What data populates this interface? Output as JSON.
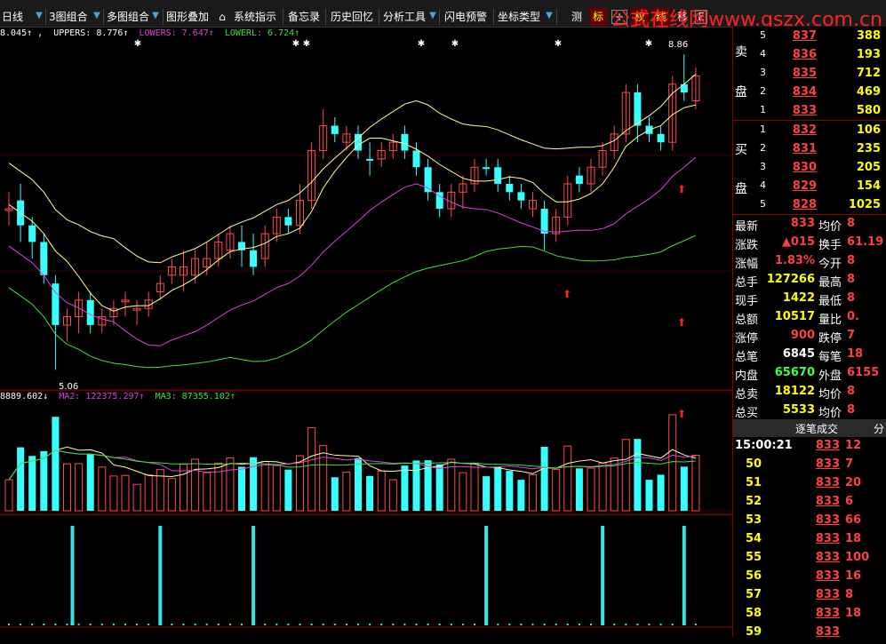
{
  "toolbar": {
    "period": "日线",
    "multi3": "3图组合",
    "multi": "多图组合",
    "overlay": "图形叠加",
    "indicators": "系统指示",
    "memo": "备忘录",
    "history": "历史回忆",
    "analysis": "分析工具",
    "alert": "闪电预警",
    "coord": "坐标类型",
    "measure": "测",
    "mark": "标",
    "quan": "权",
    "line": "线",
    "move": "移",
    "last": "E"
  },
  "watermark": "公式在线网www.gszx.com.cn",
  "legend_top": {
    "mid": "8.045↑",
    "upper": "UPPERS: 8.776↑",
    "lower": "LOWERS: 7.647↑",
    "lowerl": "LOWERL: 6.724↑"
  },
  "legend_vol": {
    "ma1": "8889.602↓",
    "ma2": "MA2: 122375.297↑",
    "ma3": "MA3: 87355.102↑"
  },
  "chart_labels": {
    "high": "8.86",
    "low": "5.06"
  },
  "chart_data": {
    "type": "candlestick",
    "colors": {
      "up": "#ff4b4b",
      "down": "#35ffff",
      "ma_white": "#ffffa0",
      "ma_magenta": "#e040e0",
      "ma_green": "#40e040"
    },
    "candles": [
      [
        7.0,
        7.2,
        6.8,
        7.0,
        "u"
      ],
      [
        7.1,
        7.3,
        6.6,
        6.8,
        "d"
      ],
      [
        6.8,
        6.9,
        6.4,
        6.6,
        "d"
      ],
      [
        6.6,
        6.7,
        6.1,
        6.2,
        "d"
      ],
      [
        6.1,
        6.2,
        5.06,
        5.6,
        "d"
      ],
      [
        5.6,
        5.8,
        5.4,
        5.7,
        "u"
      ],
      [
        5.7,
        6.0,
        5.5,
        5.9,
        "u"
      ],
      [
        5.9,
        6.0,
        5.5,
        5.6,
        "d"
      ],
      [
        5.6,
        5.8,
        5.5,
        5.7,
        "u"
      ],
      [
        5.7,
        5.9,
        5.6,
        5.8,
        "u"
      ],
      [
        5.9,
        6.0,
        5.7,
        5.9,
        "u"
      ],
      [
        5.8,
        5.9,
        5.6,
        5.8,
        "u"
      ],
      [
        5.8,
        6.0,
        5.7,
        5.9,
        "u"
      ],
      [
        6.0,
        6.2,
        5.9,
        6.1,
        "u"
      ],
      [
        6.2,
        6.4,
        6.1,
        6.3,
        "u"
      ],
      [
        6.3,
        6.5,
        6.0,
        6.2,
        "u"
      ],
      [
        6.2,
        6.5,
        6.1,
        6.4,
        "u"
      ],
      [
        6.3,
        6.6,
        6.2,
        6.4,
        "u"
      ],
      [
        6.4,
        6.7,
        6.3,
        6.6,
        "u"
      ],
      [
        6.5,
        6.8,
        6.4,
        6.7,
        "u"
      ],
      [
        6.6,
        6.8,
        6.3,
        6.5,
        "d"
      ],
      [
        6.5,
        6.7,
        6.2,
        6.3,
        "d"
      ],
      [
        6.4,
        6.8,
        6.3,
        6.7,
        "u"
      ],
      [
        6.7,
        7.0,
        6.6,
        6.9,
        "u"
      ],
      [
        6.9,
        7.0,
        6.7,
        6.8,
        "d"
      ],
      [
        6.8,
        7.3,
        6.7,
        7.1,
        "u"
      ],
      [
        7.1,
        7.8,
        7.0,
        7.7,
        "u"
      ],
      [
        7.7,
        8.2,
        7.6,
        8.0,
        "u"
      ],
      [
        8.0,
        8.1,
        7.8,
        7.9,
        "d"
      ],
      [
        7.8,
        8.0,
        7.7,
        7.9,
        "u"
      ],
      [
        7.9,
        8.0,
        7.6,
        7.7,
        "d"
      ],
      [
        7.6,
        7.8,
        7.4,
        7.6,
        "d"
      ],
      [
        7.6,
        7.8,
        7.5,
        7.7,
        "u"
      ],
      [
        7.7,
        7.9,
        7.6,
        7.8,
        "u"
      ],
      [
        7.9,
        8.0,
        7.6,
        7.7,
        "d"
      ],
      [
        7.7,
        7.8,
        7.4,
        7.5,
        "d"
      ],
      [
        7.5,
        7.6,
        7.1,
        7.2,
        "d"
      ],
      [
        7.2,
        7.3,
        6.9,
        7.0,
        "d"
      ],
      [
        7.0,
        7.3,
        6.9,
        7.2,
        "u"
      ],
      [
        7.2,
        7.4,
        7.0,
        7.3,
        "u"
      ],
      [
        7.3,
        7.6,
        7.2,
        7.5,
        "u"
      ],
      [
        7.5,
        7.6,
        7.4,
        7.5,
        "d"
      ],
      [
        7.5,
        7.6,
        7.2,
        7.3,
        "d"
      ],
      [
        7.3,
        7.4,
        7.1,
        7.2,
        "d"
      ],
      [
        7.2,
        7.3,
        7.0,
        7.1,
        "d"
      ],
      [
        7.1,
        7.2,
        6.9,
        7.0,
        "u"
      ],
      [
        7.0,
        7.1,
        6.5,
        6.7,
        "d"
      ],
      [
        6.7,
        7.0,
        6.6,
        6.9,
        "u"
      ],
      [
        6.9,
        7.4,
        6.8,
        7.3,
        "u"
      ],
      [
        7.3,
        7.5,
        7.2,
        7.4,
        "d"
      ],
      [
        7.3,
        7.6,
        7.2,
        7.5,
        "u"
      ],
      [
        7.5,
        7.8,
        7.4,
        7.7,
        "u"
      ],
      [
        7.7,
        8.0,
        7.6,
        7.9,
        "u"
      ],
      [
        7.9,
        8.5,
        7.8,
        8.4,
        "u"
      ],
      [
        8.4,
        8.5,
        7.8,
        8.0,
        "d"
      ],
      [
        8.0,
        8.1,
        7.8,
        7.9,
        "d"
      ],
      [
        7.9,
        8.0,
        7.7,
        7.8,
        "d"
      ],
      [
        7.8,
        8.6,
        7.7,
        8.5,
        "u"
      ],
      [
        8.5,
        8.86,
        8.3,
        8.4,
        "d"
      ],
      [
        8.3,
        8.7,
        8.2,
        8.6,
        "u"
      ]
    ],
    "volume_hint": "candle-colored bars",
    "signal_bars_index": [
      5,
      13,
      21,
      41,
      51,
      58
    ]
  },
  "orderbook": {
    "sell_label_1": "卖",
    "sell_label_2": "盘",
    "buy_label_1": "买",
    "buy_label_2": "盘",
    "sell": [
      {
        "n": "5",
        "p": "837",
        "v": "388"
      },
      {
        "n": "4",
        "p": "836",
        "v": "193"
      },
      {
        "n": "3",
        "p": "835",
        "v": "712"
      },
      {
        "n": "2",
        "p": "834",
        "v": "469"
      },
      {
        "n": "1",
        "p": "833",
        "v": "580"
      }
    ],
    "buy": [
      {
        "n": "1",
        "p": "832",
        "v": "106"
      },
      {
        "n": "2",
        "p": "831",
        "v": "235"
      },
      {
        "n": "3",
        "p": "830",
        "v": "205"
      },
      {
        "n": "4",
        "p": "829",
        "v": "154"
      },
      {
        "n": "5",
        "p": "828",
        "v": "1025"
      }
    ]
  },
  "quote": [
    {
      "l": "最新",
      "v": "833",
      "c": "#ff4040",
      "l2": "均价",
      "v2": "8"
    },
    {
      "l": "涨跌",
      "v": "▲015",
      "c": "#ff4040",
      "l2": "换手",
      "v2": "61.19"
    },
    {
      "l": "涨幅",
      "v": "1.83%",
      "c": "#ff4040",
      "l2": "今开",
      "v2": "8"
    },
    {
      "l": "总手",
      "v": "127266",
      "c": "#ffff00",
      "l2": "最高",
      "v2": "8"
    },
    {
      "l": "现手",
      "v": "1422",
      "c": "#ffff00",
      "l2": "最低",
      "v2": "8"
    },
    {
      "l": "总额",
      "v": "10517",
      "c": "#ffff00",
      "l2": "量比",
      "v2": "0."
    },
    {
      "l": "涨停",
      "v": "900",
      "c": "#ff4040",
      "l2": "跌停",
      "v2": "7"
    },
    {
      "l": "总笔",
      "v": "6845",
      "c": "#ffffff",
      "l2": "每笔",
      "v2": "18"
    },
    {
      "l": "内盘",
      "v": "65670",
      "c": "#40ff40",
      "l2": "外盘",
      "v2": "6155"
    },
    {
      "l": "总卖",
      "v": "18122",
      "c": "#ffff00",
      "l2": "均价",
      "v2": "8"
    },
    {
      "l": "总买",
      "v": "5533",
      "c": "#ffff00",
      "l2": "均价",
      "v2": "8"
    }
  ],
  "ticks_header": {
    "title": "逐笔成交",
    "extra": "分"
  },
  "ticks": [
    {
      "t": "15:00:21",
      "p": "833",
      "v": "12",
      "tc": "#ffffff"
    },
    {
      "t": "50",
      "p": "833",
      "v": "7",
      "tc": "#ffff00"
    },
    {
      "t": "51",
      "p": "833",
      "v": "20",
      "tc": "#ffff00"
    },
    {
      "t": "52",
      "p": "833",
      "v": "6",
      "tc": "#ffff00"
    },
    {
      "t": "53",
      "p": "833",
      "v": "66",
      "tc": "#ffff00"
    },
    {
      "t": "54",
      "p": "833",
      "v": "18",
      "tc": "#ffff00"
    },
    {
      "t": "55",
      "p": "833",
      "v": "100",
      "tc": "#ffff00"
    },
    {
      "t": "56",
      "p": "833",
      "v": "16",
      "tc": "#ffff00"
    },
    {
      "t": "57",
      "p": "833",
      "v": "8",
      "tc": "#ffff00"
    },
    {
      "t": "58",
      "p": "833",
      "v": "18",
      "tc": "#ffff00"
    },
    {
      "t": "59",
      "p": "833",
      "v": "",
      "tc": "#ffff00"
    }
  ]
}
